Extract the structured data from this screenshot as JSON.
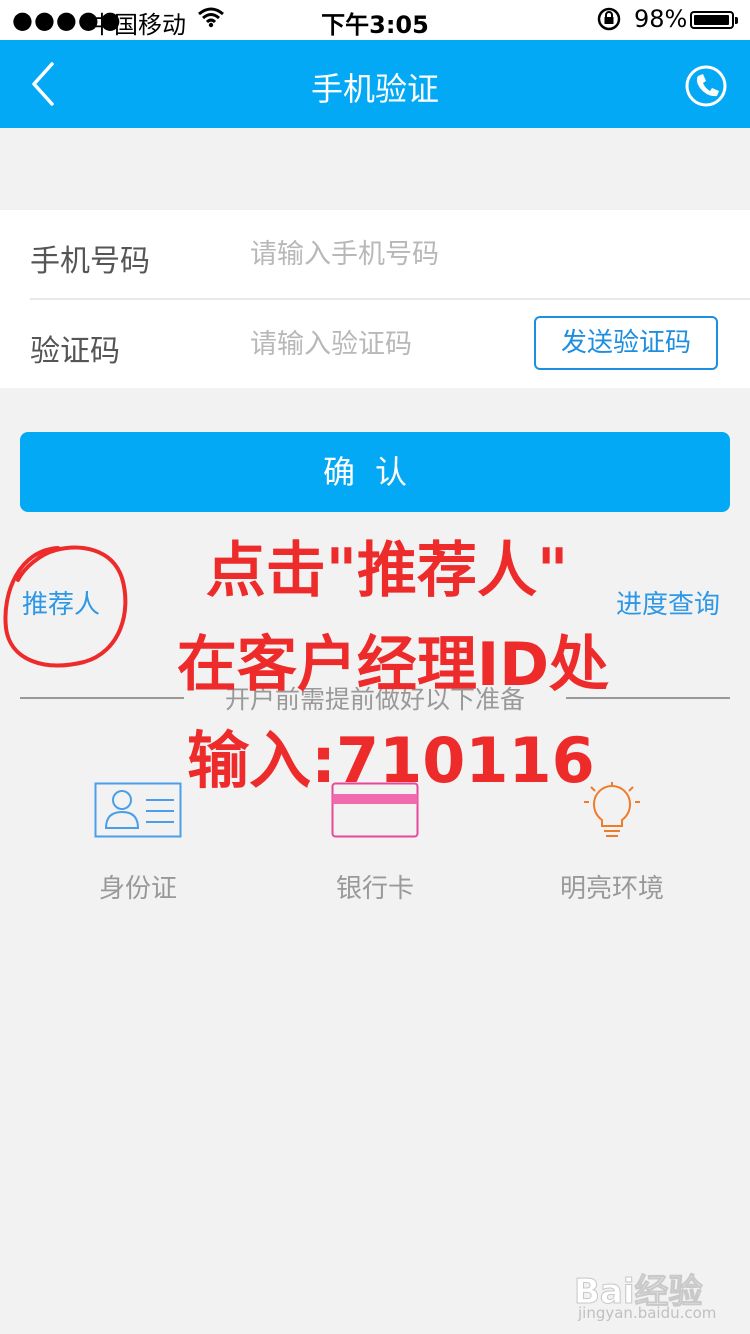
{
  "status_bar": {
    "signal": "●●●●●",
    "carrier": "中国移动",
    "time": "下午3:05",
    "battery_percent": "98%",
    "battery_level": 0.98
  },
  "navbar": {
    "title": "手机验证",
    "icons": [
      "back-chevron-icon",
      "phone-icon"
    ]
  },
  "form": {
    "phone": {
      "label": "手机号码",
      "placeholder": "请输入手机号码",
      "value": ""
    },
    "code": {
      "label": "验证码",
      "placeholder": "请输入验证码",
      "value": "",
      "send_button": "发送验证码"
    }
  },
  "confirm_button": "确认",
  "links": {
    "referrer": "推荐人",
    "progress_query": "进度查询"
  },
  "preparation": {
    "title": "开户前需提前做好以下准备",
    "items": [
      {
        "label": "身份证",
        "icon": "id-card-icon"
      },
      {
        "label": "银行卡",
        "icon": "bank-card-icon"
      },
      {
        "label": "明亮环境",
        "icon": "lightbulb-icon"
      }
    ]
  },
  "annotation": {
    "line1": "点击\"推荐人\"",
    "line2": "在客户经理ID处",
    "line3": "输入:710116"
  },
  "watermark": {
    "brand": "Bai经验",
    "url": "jingyan.baidu.com"
  },
  "colors": {
    "primary": "#03a9f4",
    "link": "#2f98e6",
    "annotation": "#ee2b2b",
    "background": "#f2f2f2"
  }
}
